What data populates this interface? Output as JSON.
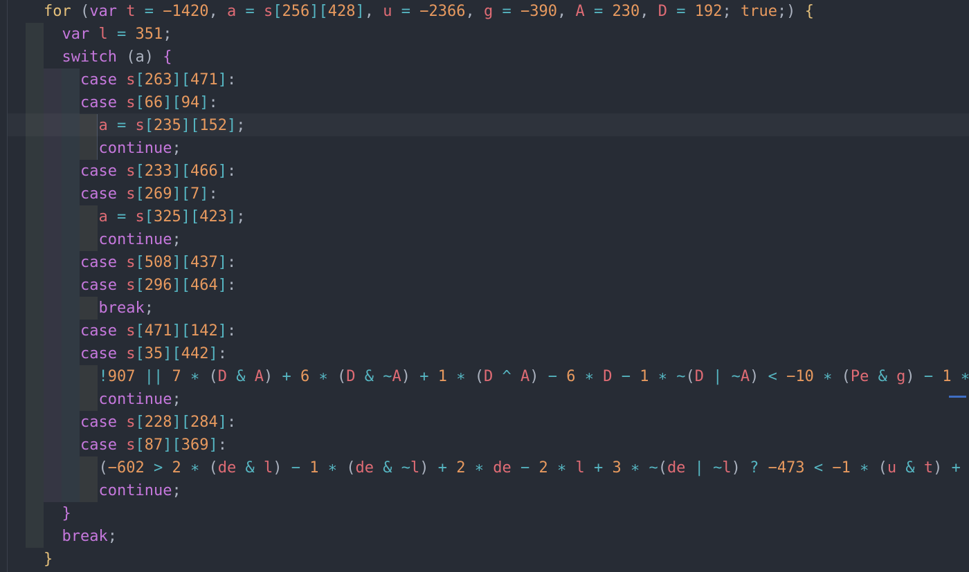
{
  "editor": {
    "current_line_index": 5,
    "lines": [
      [
        {
          "t": "for",
          "c": "kw-for"
        },
        {
          "t": " ("
        },
        {
          "t": "var",
          "c": "kw"
        },
        {
          "t": " "
        },
        {
          "t": "t",
          "c": "var"
        },
        {
          "t": " = ",
          "c": "op"
        },
        {
          "t": "−1420",
          "c": "num"
        },
        {
          "t": ", "
        },
        {
          "t": "a",
          "c": "var"
        },
        {
          "t": " = ",
          "c": "op"
        },
        {
          "t": "s",
          "c": "var"
        },
        {
          "t": "[",
          "c": "sq"
        },
        {
          "t": "256",
          "c": "num"
        },
        {
          "t": "][",
          "c": "sq"
        },
        {
          "t": "428",
          "c": "num"
        },
        {
          "t": "]",
          "c": "sq"
        },
        {
          "t": ", "
        },
        {
          "t": "u",
          "c": "var"
        },
        {
          "t": " = ",
          "c": "op"
        },
        {
          "t": "−2366",
          "c": "num"
        },
        {
          "t": ", "
        },
        {
          "t": "g",
          "c": "var"
        },
        {
          "t": " = ",
          "c": "op"
        },
        {
          "t": "−390",
          "c": "num"
        },
        {
          "t": ", "
        },
        {
          "t": "A",
          "c": "var"
        },
        {
          "t": " = ",
          "c": "op"
        },
        {
          "t": "230",
          "c": "num"
        },
        {
          "t": ", "
        },
        {
          "t": "D",
          "c": "var"
        },
        {
          "t": " = ",
          "c": "op"
        },
        {
          "t": "192",
          "c": "num"
        },
        {
          "t": "; "
        },
        {
          "t": "true",
          "c": "num"
        },
        {
          "t": ";) "
        },
        {
          "t": "{",
          "c": "brk"
        }
      ],
      [
        {
          "t": "  "
        },
        {
          "t": "var",
          "c": "kw"
        },
        {
          "t": " "
        },
        {
          "t": "l",
          "c": "var"
        },
        {
          "t": " = ",
          "c": "op"
        },
        {
          "t": "351",
          "c": "num"
        },
        {
          "t": ";"
        }
      ],
      [
        {
          "t": "  "
        },
        {
          "t": "switch",
          "c": "kw"
        },
        {
          "t": " (a) "
        },
        {
          "t": "{",
          "c": "brk2"
        }
      ],
      [
        {
          "t": "    "
        },
        {
          "t": "case",
          "c": "kw"
        },
        {
          "t": " "
        },
        {
          "t": "s",
          "c": "var"
        },
        {
          "t": "[",
          "c": "sq"
        },
        {
          "t": "263",
          "c": "num"
        },
        {
          "t": "][",
          "c": "sq"
        },
        {
          "t": "471",
          "c": "num"
        },
        {
          "t": "]",
          "c": "sq"
        },
        {
          "t": ":"
        }
      ],
      [
        {
          "t": "    "
        },
        {
          "t": "case",
          "c": "kw"
        },
        {
          "t": " "
        },
        {
          "t": "s",
          "c": "var"
        },
        {
          "t": "[",
          "c": "sq"
        },
        {
          "t": "66",
          "c": "num"
        },
        {
          "t": "][",
          "c": "sq"
        },
        {
          "t": "94",
          "c": "num"
        },
        {
          "t": "]",
          "c": "sq"
        },
        {
          "t": ":"
        }
      ],
      [
        {
          "t": "      "
        },
        {
          "t": "a",
          "c": "var"
        },
        {
          "t": " = ",
          "c": "op"
        },
        {
          "t": "s",
          "c": "var"
        },
        {
          "t": "[",
          "c": "sq"
        },
        {
          "t": "235",
          "c": "num"
        },
        {
          "t": "][",
          "c": "sq"
        },
        {
          "t": "152",
          "c": "num"
        },
        {
          "t": "]",
          "c": "sq"
        },
        {
          "t": ";"
        }
      ],
      [
        {
          "t": "      "
        },
        {
          "t": "continue",
          "c": "kw"
        },
        {
          "t": ";"
        }
      ],
      [
        {
          "t": "    "
        },
        {
          "t": "case",
          "c": "kw"
        },
        {
          "t": " "
        },
        {
          "t": "s",
          "c": "var"
        },
        {
          "t": "[",
          "c": "sq"
        },
        {
          "t": "233",
          "c": "num"
        },
        {
          "t": "][",
          "c": "sq"
        },
        {
          "t": "466",
          "c": "num"
        },
        {
          "t": "]",
          "c": "sq"
        },
        {
          "t": ":"
        }
      ],
      [
        {
          "t": "    "
        },
        {
          "t": "case",
          "c": "kw"
        },
        {
          "t": " "
        },
        {
          "t": "s",
          "c": "var"
        },
        {
          "t": "[",
          "c": "sq"
        },
        {
          "t": "269",
          "c": "num"
        },
        {
          "t": "][",
          "c": "sq"
        },
        {
          "t": "7",
          "c": "num"
        },
        {
          "t": "]",
          "c": "sq"
        },
        {
          "t": ":"
        }
      ],
      [
        {
          "t": "      "
        },
        {
          "t": "a",
          "c": "var"
        },
        {
          "t": " = ",
          "c": "op"
        },
        {
          "t": "s",
          "c": "var"
        },
        {
          "t": "[",
          "c": "sq"
        },
        {
          "t": "325",
          "c": "num"
        },
        {
          "t": "][",
          "c": "sq"
        },
        {
          "t": "423",
          "c": "num"
        },
        {
          "t": "]",
          "c": "sq"
        },
        {
          "t": ";"
        }
      ],
      [
        {
          "t": "      "
        },
        {
          "t": "continue",
          "c": "kw"
        },
        {
          "t": ";"
        }
      ],
      [
        {
          "t": "    "
        },
        {
          "t": "case",
          "c": "kw"
        },
        {
          "t": " "
        },
        {
          "t": "s",
          "c": "var"
        },
        {
          "t": "[",
          "c": "sq"
        },
        {
          "t": "508",
          "c": "num"
        },
        {
          "t": "][",
          "c": "sq"
        },
        {
          "t": "437",
          "c": "num"
        },
        {
          "t": "]",
          "c": "sq"
        },
        {
          "t": ":"
        }
      ],
      [
        {
          "t": "    "
        },
        {
          "t": "case",
          "c": "kw"
        },
        {
          "t": " "
        },
        {
          "t": "s",
          "c": "var"
        },
        {
          "t": "[",
          "c": "sq"
        },
        {
          "t": "296",
          "c": "num"
        },
        {
          "t": "][",
          "c": "sq"
        },
        {
          "t": "464",
          "c": "num"
        },
        {
          "t": "]",
          "c": "sq"
        },
        {
          "t": ":"
        }
      ],
      [
        {
          "t": "      "
        },
        {
          "t": "break",
          "c": "kw"
        },
        {
          "t": ";"
        }
      ],
      [
        {
          "t": "    "
        },
        {
          "t": "case",
          "c": "kw"
        },
        {
          "t": " "
        },
        {
          "t": "s",
          "c": "var"
        },
        {
          "t": "[",
          "c": "sq"
        },
        {
          "t": "471",
          "c": "num"
        },
        {
          "t": "][",
          "c": "sq"
        },
        {
          "t": "142",
          "c": "num"
        },
        {
          "t": "]",
          "c": "sq"
        },
        {
          "t": ":"
        }
      ],
      [
        {
          "t": "    "
        },
        {
          "t": "case",
          "c": "kw"
        },
        {
          "t": " "
        },
        {
          "t": "s",
          "c": "var"
        },
        {
          "t": "[",
          "c": "sq"
        },
        {
          "t": "35",
          "c": "num"
        },
        {
          "t": "][",
          "c": "sq"
        },
        {
          "t": "442",
          "c": "num"
        },
        {
          "t": "]",
          "c": "sq"
        },
        {
          "t": ":"
        }
      ],
      [
        {
          "t": "      "
        },
        {
          "t": "!",
          "c": "op"
        },
        {
          "t": "907",
          "c": "num"
        },
        {
          "t": " || ",
          "c": "op"
        },
        {
          "t": "7",
          "c": "num"
        },
        {
          "t": " ∗ ",
          "c": "op"
        },
        {
          "t": "("
        },
        {
          "t": "D",
          "c": "var"
        },
        {
          "t": " & ",
          "c": "op"
        },
        {
          "t": "A",
          "c": "var"
        },
        {
          "t": ")"
        },
        {
          "t": " + ",
          "c": "op"
        },
        {
          "t": "6",
          "c": "num"
        },
        {
          "t": " ∗ ",
          "c": "op"
        },
        {
          "t": "("
        },
        {
          "t": "D",
          "c": "var"
        },
        {
          "t": " & ~",
          "c": "op"
        },
        {
          "t": "A",
          "c": "var"
        },
        {
          "t": ")"
        },
        {
          "t": " + ",
          "c": "op"
        },
        {
          "t": "1",
          "c": "num"
        },
        {
          "t": " ∗ ",
          "c": "op"
        },
        {
          "t": "("
        },
        {
          "t": "D",
          "c": "var"
        },
        {
          "t": " ^ ",
          "c": "op"
        },
        {
          "t": "A",
          "c": "var"
        },
        {
          "t": ")"
        },
        {
          "t": " − ",
          "c": "op"
        },
        {
          "t": "6",
          "c": "num"
        },
        {
          "t": " ∗ ",
          "c": "op"
        },
        {
          "t": "D",
          "c": "var"
        },
        {
          "t": " − ",
          "c": "op"
        },
        {
          "t": "1",
          "c": "num"
        },
        {
          "t": " ∗ ~",
          "c": "op"
        },
        {
          "t": "("
        },
        {
          "t": "D",
          "c": "var"
        },
        {
          "t": " | ~",
          "c": "op"
        },
        {
          "t": "A",
          "c": "var"
        },
        {
          "t": ")"
        },
        {
          "t": " < ",
          "c": "op"
        },
        {
          "t": "−10",
          "c": "num"
        },
        {
          "t": " ∗ ",
          "c": "op"
        },
        {
          "t": "("
        },
        {
          "t": "Pe",
          "c": "var"
        },
        {
          "t": " & ",
          "c": "op"
        },
        {
          "t": "g",
          "c": "var"
        },
        {
          "t": ")"
        },
        {
          "t": " − ",
          "c": "op"
        },
        {
          "t": "1",
          "c": "num"
        },
        {
          "t": " ∗",
          "c": "op"
        }
      ],
      [
        {
          "t": "      "
        },
        {
          "t": "continue",
          "c": "kw"
        },
        {
          "t": ";"
        }
      ],
      [
        {
          "t": "    "
        },
        {
          "t": "case",
          "c": "kw"
        },
        {
          "t": " "
        },
        {
          "t": "s",
          "c": "var"
        },
        {
          "t": "[",
          "c": "sq"
        },
        {
          "t": "228",
          "c": "num"
        },
        {
          "t": "][",
          "c": "sq"
        },
        {
          "t": "284",
          "c": "num"
        },
        {
          "t": "]",
          "c": "sq"
        },
        {
          "t": ":"
        }
      ],
      [
        {
          "t": "    "
        },
        {
          "t": "case",
          "c": "kw"
        },
        {
          "t": " "
        },
        {
          "t": "s",
          "c": "var"
        },
        {
          "t": "[",
          "c": "sq"
        },
        {
          "t": "87",
          "c": "num"
        },
        {
          "t": "][",
          "c": "sq"
        },
        {
          "t": "369",
          "c": "num"
        },
        {
          "t": "]",
          "c": "sq"
        },
        {
          "t": ":"
        }
      ],
      [
        {
          "t": "      "
        },
        {
          "t": "("
        },
        {
          "t": "−602",
          "c": "num"
        },
        {
          "t": " > ",
          "c": "op"
        },
        {
          "t": "2",
          "c": "num"
        },
        {
          "t": " ∗ ",
          "c": "op"
        },
        {
          "t": "("
        },
        {
          "t": "de",
          "c": "var"
        },
        {
          "t": " & ",
          "c": "op"
        },
        {
          "t": "l",
          "c": "var"
        },
        {
          "t": ")"
        },
        {
          "t": " − ",
          "c": "op"
        },
        {
          "t": "1",
          "c": "num"
        },
        {
          "t": " ∗ ",
          "c": "op"
        },
        {
          "t": "("
        },
        {
          "t": "de",
          "c": "var"
        },
        {
          "t": " & ~",
          "c": "op"
        },
        {
          "t": "l",
          "c": "var"
        },
        {
          "t": ")"
        },
        {
          "t": " + ",
          "c": "op"
        },
        {
          "t": "2",
          "c": "num"
        },
        {
          "t": " ∗ ",
          "c": "op"
        },
        {
          "t": "de",
          "c": "var"
        },
        {
          "t": " − ",
          "c": "op"
        },
        {
          "t": "2",
          "c": "num"
        },
        {
          "t": " ∗ ",
          "c": "op"
        },
        {
          "t": "l",
          "c": "var"
        },
        {
          "t": " + ",
          "c": "op"
        },
        {
          "t": "3",
          "c": "num"
        },
        {
          "t": " ∗ ~",
          "c": "op"
        },
        {
          "t": "("
        },
        {
          "t": "de",
          "c": "var"
        },
        {
          "t": " | ~",
          "c": "op"
        },
        {
          "t": "l",
          "c": "var"
        },
        {
          "t": ")"
        },
        {
          "t": " ? ",
          "c": "op"
        },
        {
          "t": "−473",
          "c": "num"
        },
        {
          "t": " < ",
          "c": "op"
        },
        {
          "t": "−1",
          "c": "num"
        },
        {
          "t": " ∗ ",
          "c": "op"
        },
        {
          "t": "("
        },
        {
          "t": "u",
          "c": "var"
        },
        {
          "t": " & ",
          "c": "op"
        },
        {
          "t": "t",
          "c": "var"
        },
        {
          "t": ")"
        },
        {
          "t": " +",
          "c": "op"
        }
      ],
      [
        {
          "t": "      "
        },
        {
          "t": "continue",
          "c": "kw"
        },
        {
          "t": ";"
        }
      ],
      [
        {
          "t": "  "
        },
        {
          "t": "}",
          "c": "brk2"
        }
      ],
      [
        {
          "t": "  "
        },
        {
          "t": "break",
          "c": "kw"
        },
        {
          "t": ";"
        }
      ],
      [
        {
          "t": "}",
          "c": "brk"
        }
      ]
    ]
  },
  "colors": {
    "background": "#272c35",
    "keyword": "#c678dd",
    "variable": "#e06c75",
    "number": "#e89a5f",
    "operator": "#56b6c2",
    "plain": "#abb2bf"
  }
}
